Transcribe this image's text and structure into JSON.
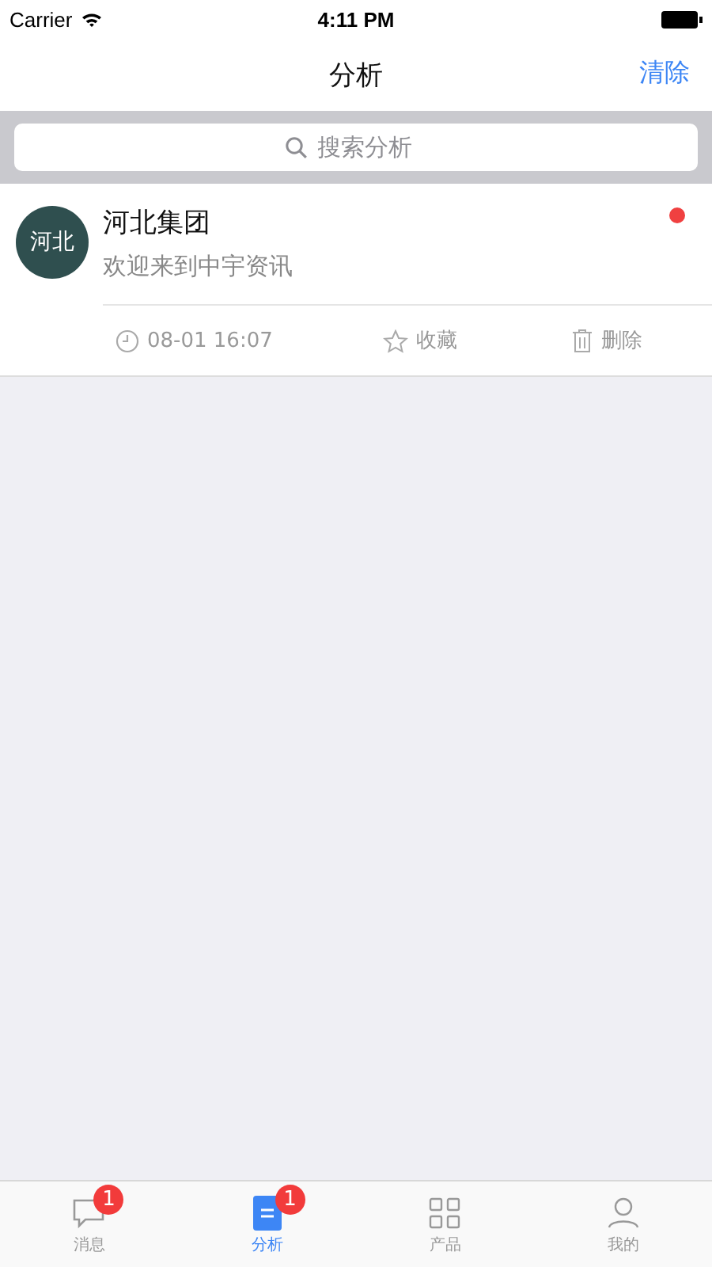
{
  "status_bar": {
    "carrier": "Carrier",
    "time": "4:11 PM"
  },
  "nav": {
    "title": "分析",
    "action": "清除"
  },
  "search": {
    "placeholder": "搜索分析"
  },
  "messages": [
    {
      "avatar": "河北",
      "title": "河北集团",
      "subtitle": "欢迎来到中宇资讯",
      "unread": true,
      "time": "08-01 16:07",
      "favorite": "收藏",
      "delete": "删除"
    }
  ],
  "tabs": [
    {
      "kind": "chat",
      "label": "消息",
      "badge": "1",
      "selected": false
    },
    {
      "kind": "doc",
      "label": "分析",
      "badge": "1",
      "selected": true
    },
    {
      "kind": "grid",
      "label": "产品",
      "selected": false
    },
    {
      "kind": "person",
      "label": "我的",
      "selected": false
    }
  ]
}
